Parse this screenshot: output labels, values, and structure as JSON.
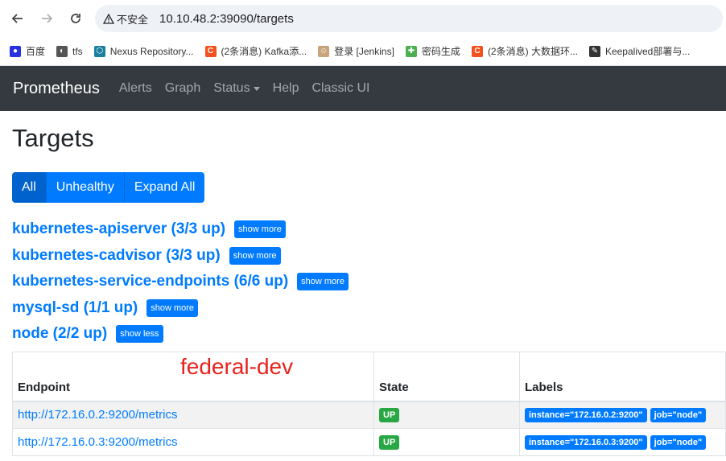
{
  "browser": {
    "security_label": "不安全",
    "url": "10.10.48.2:39090/targets"
  },
  "bookmarks": [
    {
      "label": "百度",
      "icon": "baidu-paw-icon",
      "color": "#2932e1"
    },
    {
      "label": "tfs",
      "icon": "globe-icon",
      "color": "#555555"
    },
    {
      "label": "Nexus Repository...",
      "icon": "nexus-hexagon-icon",
      "color": "#1b7fa0"
    },
    {
      "label": "(2条消息) Kafka添...",
      "icon": "csdn-c-icon",
      "color": "#f4511e"
    },
    {
      "label": "登录 [Jenkins]",
      "icon": "jenkins-icon",
      "color": "#c9a47a"
    },
    {
      "label": "密码生成",
      "icon": "puzzle-icon",
      "color": "#4caf50"
    },
    {
      "label": "(2条消息) 大数据环...",
      "icon": "csdn-c-icon",
      "color": "#f4511e"
    },
    {
      "label": "Keepalived部署与...",
      "icon": "pen-icon",
      "color": "#333333"
    }
  ],
  "navbar": {
    "brand": "Prometheus",
    "links": [
      "Alerts",
      "Graph",
      "Status",
      "Help",
      "Classic UI"
    ]
  },
  "page": {
    "title": "Targets",
    "filters": [
      "All",
      "Unhealthy",
      "Expand All"
    ]
  },
  "pools": [
    {
      "title": "kubernetes-apiserver (3/3 up)",
      "toggle": "show more"
    },
    {
      "title": "kubernetes-cadvisor (3/3 up)",
      "toggle": "show more"
    },
    {
      "title": "kubernetes-service-endpoints (6/6 up)",
      "toggle": "show more"
    },
    {
      "title": "mysql-sd (1/1 up)",
      "toggle": "show more"
    },
    {
      "title": "node (2/2 up)",
      "toggle": "show less"
    }
  ],
  "annotation": "federal-dev",
  "table": {
    "headers": [
      "Endpoint",
      "State",
      "Labels"
    ],
    "rows": [
      {
        "endpoint": "http://172.16.0.2:9200/metrics",
        "state": "UP",
        "labels": [
          "instance=\"172.16.0.2:9200\"",
          "job=\"node\""
        ]
      },
      {
        "endpoint": "http://172.16.0.3:9200/metrics",
        "state": "UP",
        "labels": [
          "instance=\"172.16.0.3:9200\"",
          "job=\"node\""
        ]
      }
    ]
  },
  "colors": {
    "primary": "#007bff",
    "success": "#28a745",
    "navbar": "#343a40",
    "annotation": "#e8231d"
  }
}
